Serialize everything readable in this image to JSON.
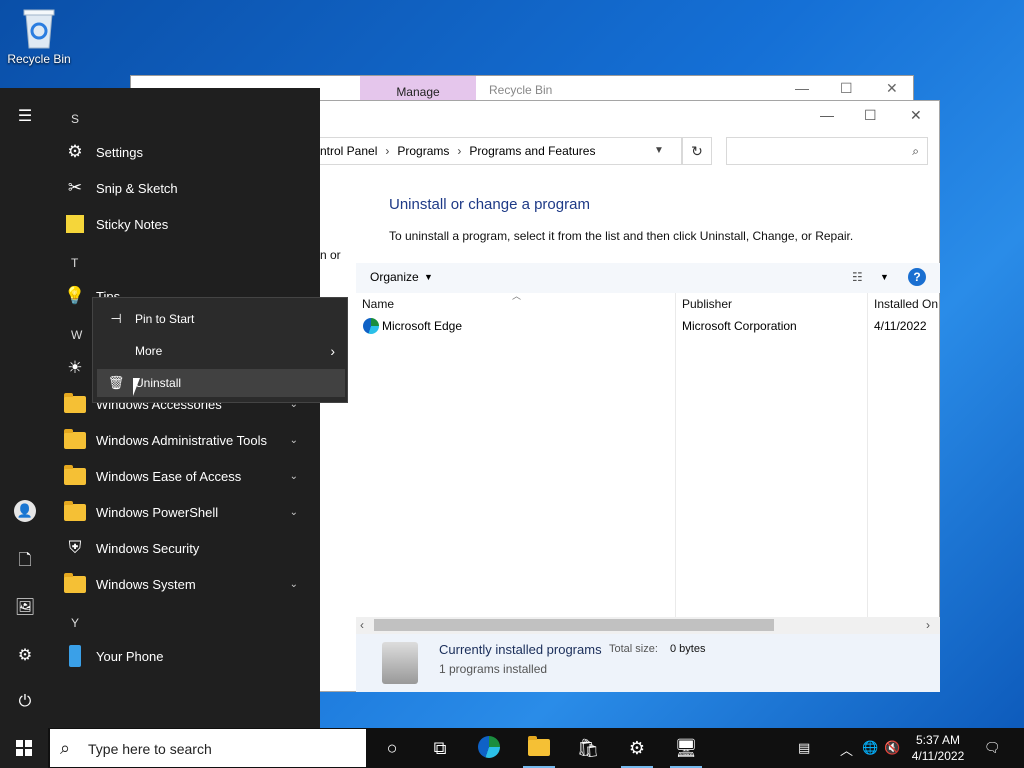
{
  "desktop": {
    "recycle_bin_label": "Recycle Bin"
  },
  "back_window": {
    "manage_tab": "Manage",
    "title": "Recycle Bin"
  },
  "front_window": {
    "breadcrumb": [
      "ntrol Panel",
      "Programs",
      "Programs and Features"
    ],
    "search_placeholder": "",
    "heading": "Uninstall or change a program",
    "description": "To uninstall a program, select it from the list and then click Uninstall, Change, or Repair.",
    "left_pane_peek": "n or",
    "toolbar": {
      "organize": "Organize"
    },
    "columns": [
      "Name",
      "Publisher",
      "Installed On"
    ],
    "rows": [
      {
        "name": "Microsoft Edge",
        "publisher": "Microsoft Corporation",
        "installed_on": "4/11/2022"
      }
    ],
    "status": {
      "title": "Currently installed programs",
      "total_size_label": "Total size:",
      "total_size_value": "0 bytes",
      "count": "1 programs installed"
    }
  },
  "start_menu": {
    "letters": {
      "s": "S",
      "t": "T",
      "w": "W",
      "y": "Y"
    },
    "apps": {
      "settings": "Settings",
      "snip": "Snip & Sketch",
      "sticky": "Sticky Notes",
      "tips": "Tips",
      "accessories": "Windows Accessories",
      "admin": "Windows Administrative Tools",
      "ease": "Windows Ease of Access",
      "powershell": "Windows PowerShell",
      "security": "Windows Security",
      "system": "Windows System",
      "phone": "Your Phone"
    }
  },
  "context_menu": {
    "pin": "Pin to Start",
    "more": "More",
    "uninstall": "Uninstall"
  },
  "taskbar": {
    "search_placeholder": "Type here to search",
    "time": "5:37 AM",
    "date": "4/11/2022"
  }
}
